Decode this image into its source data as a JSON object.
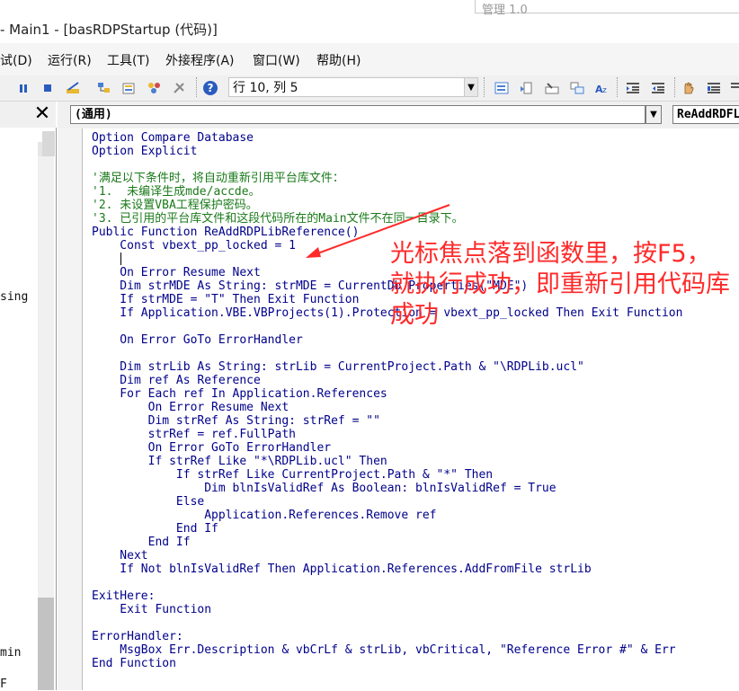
{
  "window": {
    "title": "- Main1 - [basRDPStartup (代码)]",
    "background_window_text": "管理 1.0"
  },
  "menu": [
    "试(D)",
    "运行(R)",
    "工具(T)",
    "外接程序(A)",
    "窗口(W)",
    "帮助(H)"
  ],
  "toolbar": {
    "position_text": "行 10, 列 5",
    "icons": [
      "pause-icon",
      "stop-icon",
      "design-mode-icon",
      "project-explorer-icon",
      "properties-icon",
      "object-browser-icon",
      "toolbox-icon",
      "help-icon"
    ],
    "right_icons": [
      "list-properties-icon",
      "list-constants-icon",
      "quick-info-icon",
      "parameter-info-icon",
      "complete-word-icon",
      "indent-icon",
      "outdent-icon",
      "toggle-breakpoint-icon",
      "comment-block-icon"
    ]
  },
  "project_pane": {
    "close_label": "✕",
    "fragments": [
      {
        "text": "sing"
      },
      {
        "text": "min"
      },
      {
        "text": "F"
      }
    ]
  },
  "code_window": {
    "object_combo": "(通用)",
    "procedure_combo": "ReAddRDFLi"
  },
  "code_lines": [
    [
      {
        "t": "Option Compare Database",
        "c": "kw"
      }
    ],
    [
      {
        "t": "Option Explicit",
        "c": "kw"
      }
    ],
    [
      {
        "t": "",
        "c": ""
      }
    ],
    [
      {
        "t": "'满足以下条件时，将自动重新引用平台库文件：",
        "c": "cm"
      }
    ],
    [
      {
        "t": "'1.  未编译生成mde/accde。",
        "c": "cm"
      }
    ],
    [
      {
        "t": "'2. 未设置VBA工程保护密码。",
        "c": "cm"
      }
    ],
    [
      {
        "t": "'3. 已引用的平台库文件和这段代码所在的Main文件不在同一目录下。",
        "c": "cm"
      }
    ],
    [
      {
        "t": "Public Function ReAddRDPLibReference()",
        "c": "kw"
      }
    ],
    [
      {
        "t": "    Const vbext_pp_locked = 1",
        "c": "kw"
      }
    ],
    [
      {
        "t": "",
        "c": ""
      }
    ],
    [
      {
        "t": "    On Error Resume Next",
        "c": "kw"
      }
    ],
    [
      {
        "t": "    Dim strMDE As String: strMDE = CurrentDb.Properties(\"MDE\")",
        "c": "kw"
      }
    ],
    [
      {
        "t": "    If strMDE = \"T\" Then Exit Function",
        "c": "kw"
      }
    ],
    [
      {
        "t": "    If Application.VBE.VBProjects(1).Protection = vbext_pp_locked Then Exit Function",
        "c": "kw"
      }
    ],
    [
      {
        "t": "",
        "c": ""
      }
    ],
    [
      {
        "t": "    On Error GoTo ErrorHandler",
        "c": "kw"
      }
    ],
    [
      {
        "t": "",
        "c": ""
      }
    ],
    [
      {
        "t": "    Dim strLib As String: strLib = CurrentProject.Path & \"\\RDPLib.ucl\"",
        "c": "kw"
      }
    ],
    [
      {
        "t": "    Dim ref As Reference",
        "c": "kw"
      }
    ],
    [
      {
        "t": "    For Each ref In Application.References",
        "c": "kw"
      }
    ],
    [
      {
        "t": "        On Error Resume Next",
        "c": "kw"
      }
    ],
    [
      {
        "t": "        Dim strRef As String: strRef = \"\"",
        "c": "kw"
      }
    ],
    [
      {
        "t": "        strRef = ref.FullPath",
        "c": "kw"
      }
    ],
    [
      {
        "t": "        On Error GoTo ErrorHandler",
        "c": "kw"
      }
    ],
    [
      {
        "t": "        If strRef Like \"*\\RDPLib.ucl\" Then",
        "c": "kw"
      }
    ],
    [
      {
        "t": "            If strRef Like CurrentProject.Path & \"*\" Then",
        "c": "kw"
      }
    ],
    [
      {
        "t": "                Dim blnIsValidRef As Boolean: blnIsValidRef = True",
        "c": "kw"
      }
    ],
    [
      {
        "t": "            Else",
        "c": "kw"
      }
    ],
    [
      {
        "t": "                Application.References.Remove ref",
        "c": "kw"
      }
    ],
    [
      {
        "t": "            End If",
        "c": "kw"
      }
    ],
    [
      {
        "t": "        End If",
        "c": "kw"
      }
    ],
    [
      {
        "t": "    Next",
        "c": "kw"
      }
    ],
    [
      {
        "t": "    If Not blnIsValidRef Then Application.References.AddFromFile strLib",
        "c": "kw"
      }
    ],
    [
      {
        "t": "",
        "c": ""
      }
    ],
    [
      {
        "t": "ExitHere:",
        "c": "kw"
      }
    ],
    [
      {
        "t": "    Exit Function",
        "c": "kw"
      }
    ],
    [
      {
        "t": "",
        "c": ""
      }
    ],
    [
      {
        "t": "ErrorHandler:",
        "c": "kw"
      }
    ],
    [
      {
        "t": "    MsgBox Err.Description & vbCrLf & strLib, vbCritical, \"Reference Error #\" & Err",
        "c": "kw"
      }
    ],
    [
      {
        "t": "End Function",
        "c": "kw"
      }
    ]
  ],
  "annotation": {
    "text": "光标焦点落到函数里，按F5，就执行成功，即重新引用代码库成功",
    "color": "#ff2a2a"
  }
}
